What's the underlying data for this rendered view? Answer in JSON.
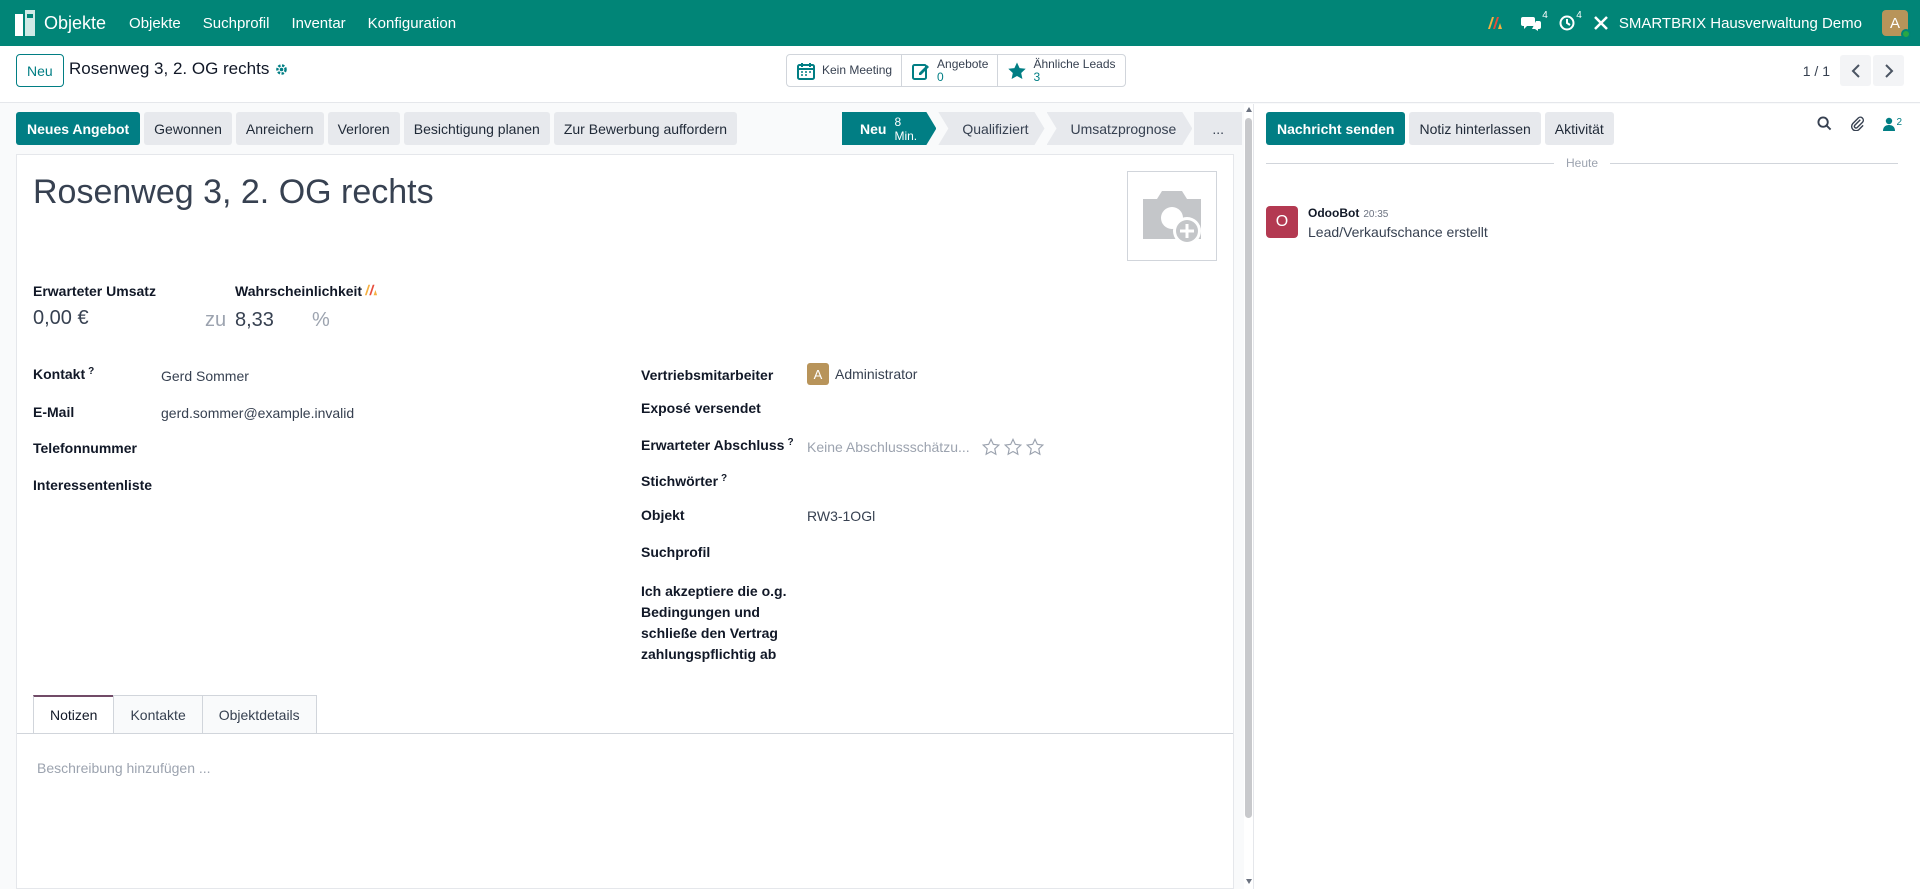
{
  "nav": {
    "app_name": "Objekte",
    "menu": [
      "Objekte",
      "Suchprofil",
      "Inventar",
      "Konfiguration"
    ],
    "messages_count": "4",
    "activities_count": "4",
    "company": "SMARTBRIX Hausverwaltung Demo",
    "user_initial": "A"
  },
  "control": {
    "new_label": "Neu",
    "breadcrumb": "Rosenweg 3, 2. OG rechts",
    "stats": [
      {
        "label": "Kein Meeting",
        "value": ""
      },
      {
        "label": "Angebote",
        "value": "0"
      },
      {
        "label": "Ähnliche Leads",
        "value": "3"
      }
    ],
    "pager": "1 / 1"
  },
  "actions": [
    "Neues Angebot",
    "Gewonnen",
    "Anreichern",
    "Verloren",
    "Besichtigung planen",
    "Zur Bewerbung auffordern"
  ],
  "stages": [
    {
      "label": "Neu",
      "time": "8 Min."
    },
    {
      "label": "Qualifiziert"
    },
    {
      "label": "Umsatzprognose"
    },
    {
      "label": "..."
    }
  ],
  "form": {
    "title": "Rosenweg 3, 2. OG rechts",
    "expected_revenue_label": "Erwarteter Umsatz",
    "expected_revenue": "0,00 €",
    "probability_label": "Wahrscheinlichkeit",
    "at_label": "zu",
    "probability": "8,33",
    "percent": "%",
    "left_fields": [
      {
        "label": "Kontakt",
        "value": "Gerd Sommer"
      },
      {
        "label": "E-Mail",
        "value": "gerd.sommer@example.invalid"
      },
      {
        "label": "Telefonnummer",
        "value": ""
      },
      {
        "label": "Interessentenliste",
        "value": ""
      }
    ],
    "salesperson_label": "Vertriebsmitarbeiter",
    "salesperson_initial": "A",
    "salesperson": "Administrator",
    "expose_label": "Exposé versendet",
    "closing_label": "Erwarteter Abschluss",
    "closing_placeholder": "Keine Abschlussschätzu...",
    "tags_label": "Stichwörter",
    "object_label": "Objekt",
    "object_value": "RW3-1OGl",
    "search_profile_label": "Suchprofil",
    "accept_label": "Ich akzeptiere die o.g. Bedingungen und schließe den Vertrag zahlungspflichtig ab",
    "help_mark": "?",
    "priority_stars": 0
  },
  "tabs": [
    "Notizen",
    "Kontakte",
    "Objektdetails"
  ],
  "notes_placeholder": "Beschreibung hinzufügen ...",
  "chatter": {
    "send_message": "Nachricht senden",
    "log_note": "Notiz hinterlassen",
    "activity": "Aktivität",
    "followers_count": "2",
    "date_separator": "Heute",
    "message": {
      "avatar": "O",
      "author": "OdooBot",
      "time": "20:35",
      "body": "Lead/Verkaufschance erstellt"
    }
  },
  "colors": {
    "brand": "#018577",
    "primary": "#017e84",
    "tab_accent": "#714b67"
  }
}
